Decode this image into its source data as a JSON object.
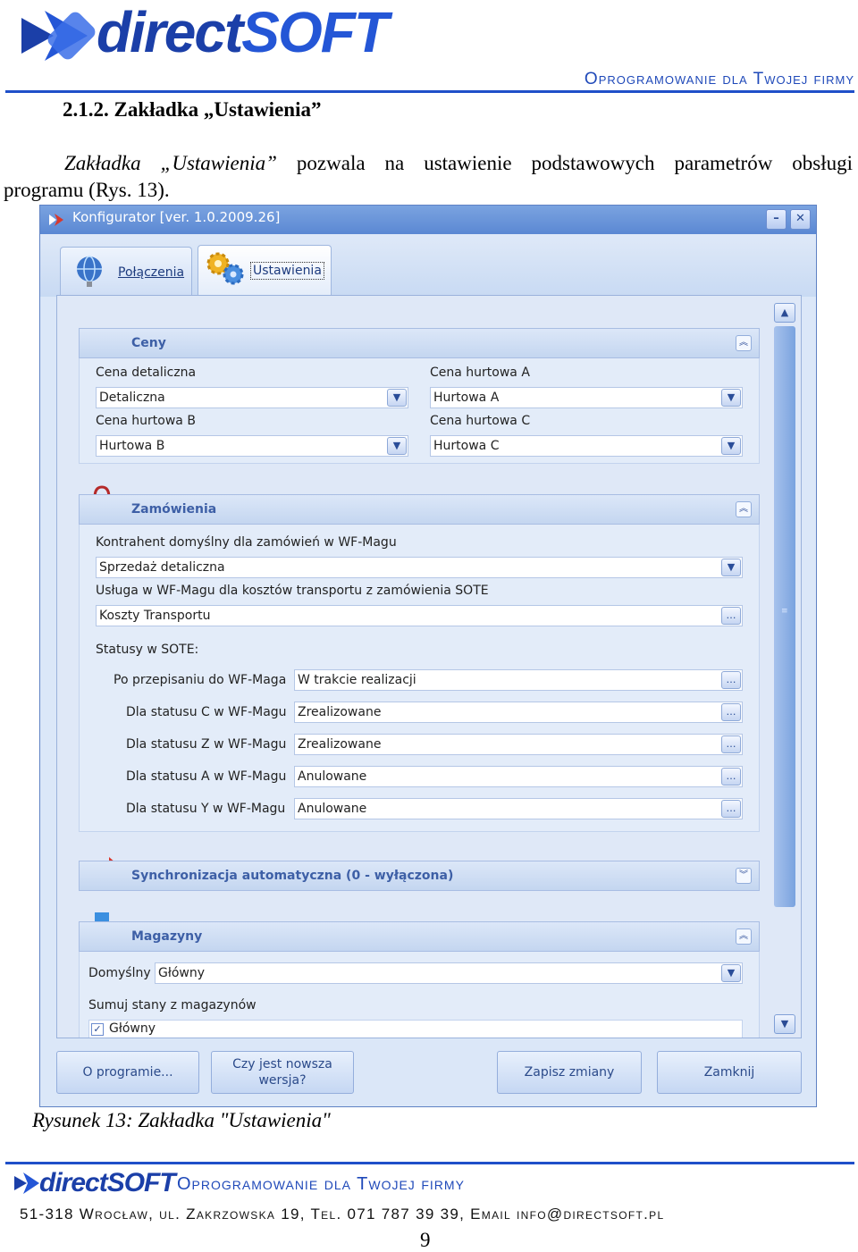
{
  "header": {
    "logo_text_a": "direct",
    "logo_text_b": "SOFT",
    "tagline": "Oprogramowanie dla Twojej firmy"
  },
  "section_heading": "2.1.2. Zakładka „Ustawienia”",
  "intro": {
    "italic": "Zakładka „Ustawienia”",
    "line1_rest": "pozwala na ustawienie podstawowych parametrów obsługi",
    "line2": "programu (Rys. 13)."
  },
  "window": {
    "title": "Konfigurator [ver. 1.0.2009.26]",
    "tabs": [
      {
        "label": "Połączenia",
        "icon": "globe-icon"
      },
      {
        "label": "Ustawienia",
        "icon": "gears-icon"
      }
    ],
    "ceny": {
      "title": "Ceny",
      "fields": [
        {
          "label": "Cena detaliczna",
          "value": "Detaliczna"
        },
        {
          "label": "Cena hurtowa A",
          "value": "Hurtowa A"
        },
        {
          "label": "Cena hurtowa B",
          "value": "Hurtowa B"
        },
        {
          "label": "Cena hurtowa C",
          "value": "Hurtowa C"
        }
      ]
    },
    "zamowienia": {
      "title": "Zamówienia",
      "kontrahent_label": "Kontrahent domyślny dla zamówień w WF-Magu",
      "kontrahent_value": "Sprzedaż detaliczna",
      "usluga_label": "Usługa w WF-Magu dla kosztów transportu z zamówienia SOTE",
      "usluga_value": "Koszty Transportu",
      "statusy_label": "Statusy w SOTE:",
      "statusy": [
        {
          "label": "Po przepisaniu do WF-Maga",
          "value": "W trakcie realizacji"
        },
        {
          "label": "Dla statusu C w WF-Magu",
          "value": "Zrealizowane"
        },
        {
          "label": "Dla statusu Z w WF-Magu",
          "value": "Zrealizowane"
        },
        {
          "label": "Dla statusu A w WF-Magu",
          "value": "Anulowane"
        },
        {
          "label": "Dla statusu Y w WF-Magu",
          "value": "Anulowane"
        }
      ]
    },
    "synchronizacja": {
      "title": "Synchronizacja automatyczna (0 - wyłączona)"
    },
    "magazyny": {
      "title": "Magazyny",
      "domyslny_label": "Domyślny",
      "domyslny_value": "Główny",
      "sumuj_label": "Sumuj stany z magazynów",
      "checkbox_label": "Główny",
      "checkbox_checked": true
    },
    "buttons": {
      "about": "O programie...",
      "update": "Czy jest nowsza wersja?",
      "save": "Zapisz zmiany",
      "close": "Zamknij"
    }
  },
  "caption": "Rysunek 13: Zakładka \"Ustawienia\"",
  "footer": {
    "logo_text": "directSOFT",
    "tagline": "Oprogramowanie dla Twojej firmy",
    "address": "51-318 Wrocław, ul. Zakrzowska 19, Tel. 071 787 39 39, Email info@directsoft.pl",
    "page_number": "9"
  },
  "colors": {
    "brand_blue": "#1f4fc9",
    "window_title": "#5b88d3",
    "group_title": "#3d5fa6"
  }
}
